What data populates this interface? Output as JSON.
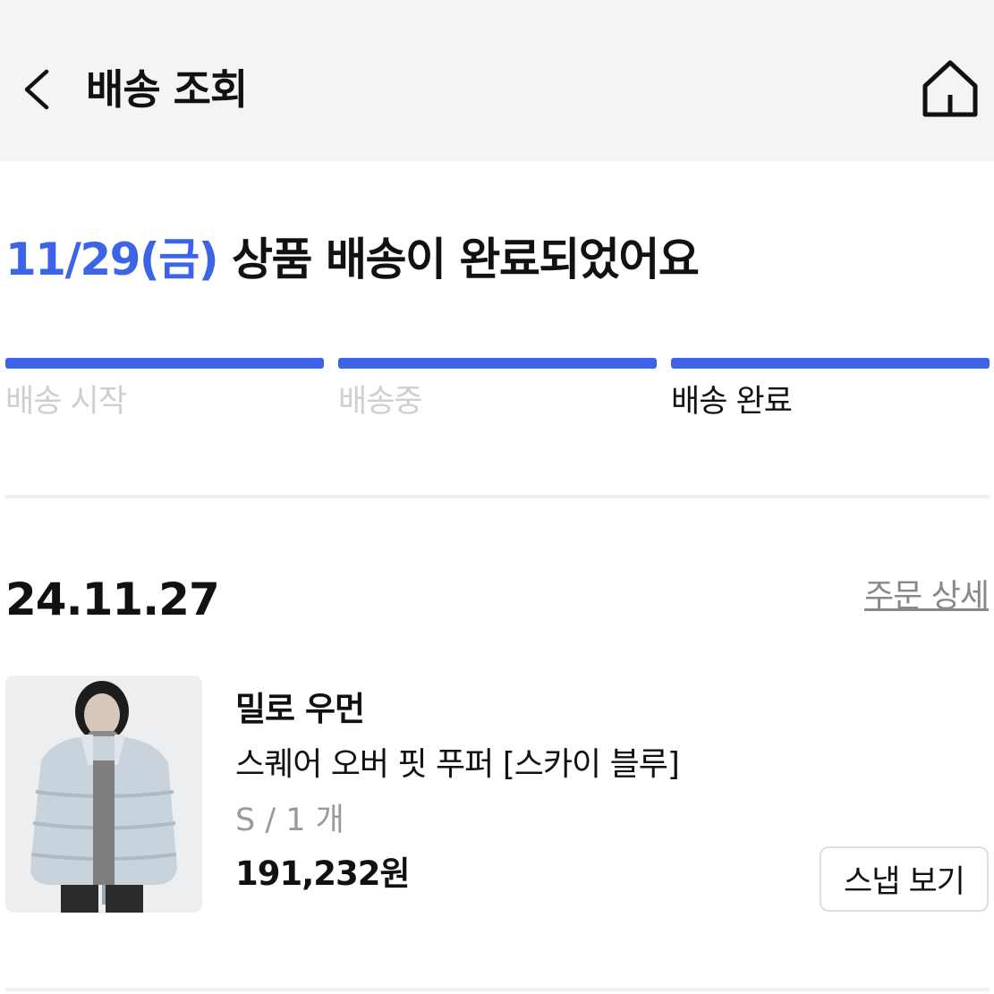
{
  "header": {
    "title": "배송 조회",
    "back_icon": "chevron-left-icon",
    "home_icon": "home-icon"
  },
  "status": {
    "date": "11/29(금)",
    "message": " 상품 배송이 완료되었어요",
    "accent_color": "#3d63e6"
  },
  "progress": {
    "steps": [
      {
        "label": "배송 시작",
        "state": "inactive"
      },
      {
        "label": "배송중",
        "state": "inactive"
      },
      {
        "label": "배송 완료",
        "state": "active"
      }
    ]
  },
  "order": {
    "date": "24.11.27",
    "detail_link": "주문 상세",
    "item": {
      "brand": "밀로 우먼",
      "name": "스퀘어 오버 핏 푸퍼 [스카이 블루]",
      "option": "S / 1 개",
      "price": "191,232원",
      "snap_button": "스냅 보기"
    }
  }
}
